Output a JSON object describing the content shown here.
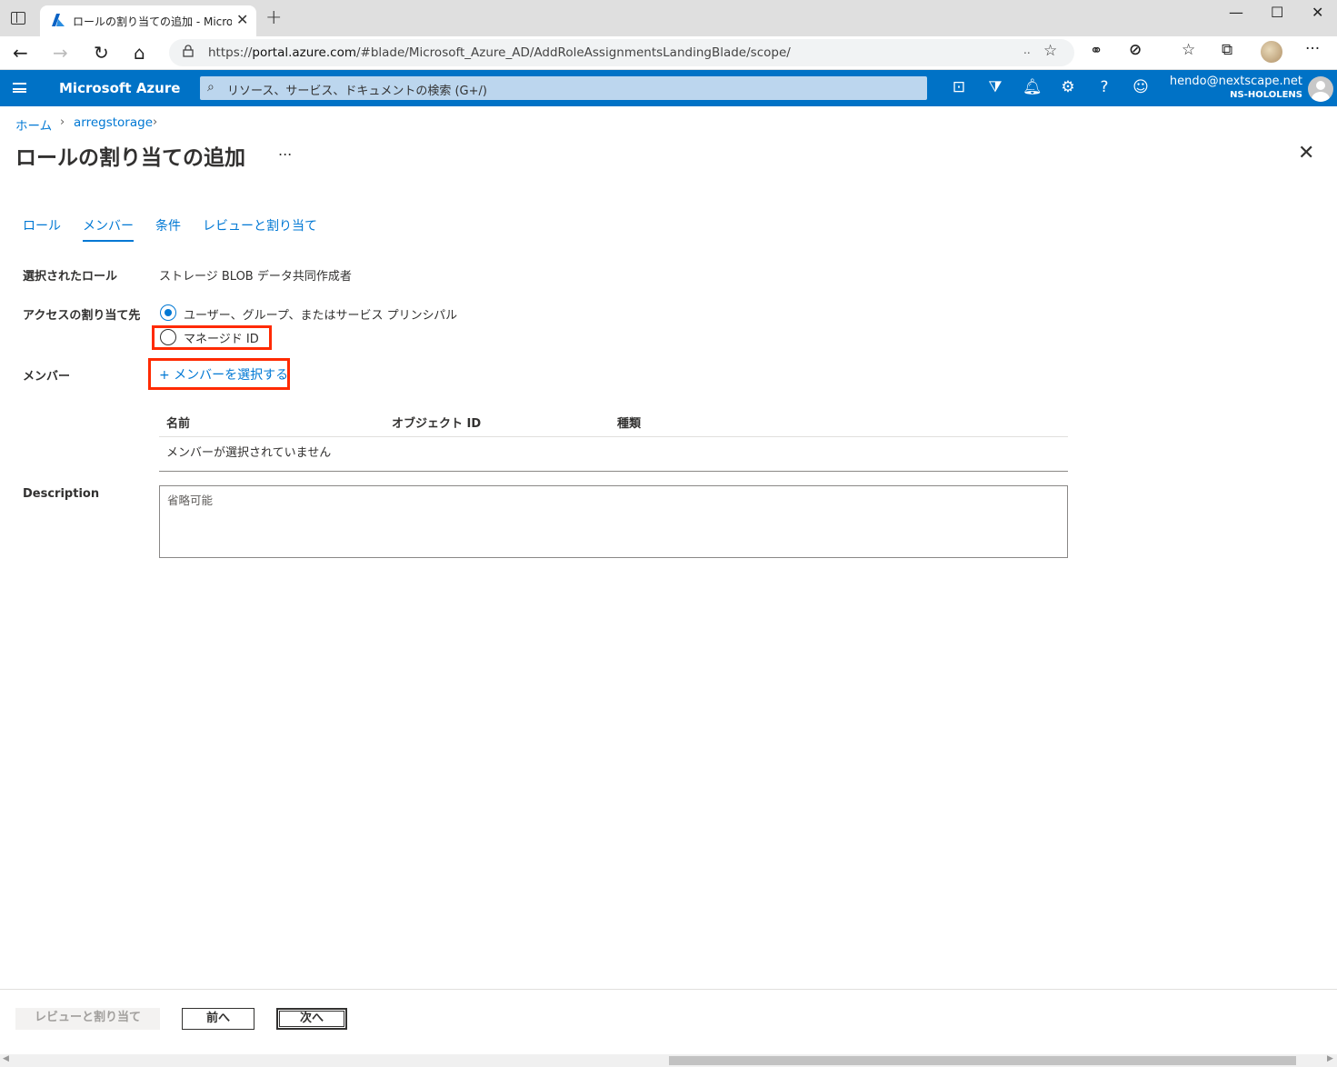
{
  "browser": {
    "tab_title": "ロールの割り当ての追加 - Microsoft",
    "url_prefix": "https://",
    "url_host": "portal.azure.com",
    "url_path": "/#blade/Microsoft_Azure_AD/AddRoleAssignmentsLandingBlade/scope/",
    "url_ellipsis": ".."
  },
  "azure": {
    "brand": "Microsoft Azure",
    "search_placeholder": "リソース、サービス、ドキュメントの検索 (G+/)",
    "user_email": "hendo@nextscape.net",
    "user_tenant": "NS-HOLOLENS"
  },
  "breadcrumb": {
    "home": "ホーム",
    "storage": "arregstorage"
  },
  "page": {
    "title": "ロールの割り当ての追加",
    "more": "..."
  },
  "tabs": [
    {
      "label": "ロール"
    },
    {
      "label": "メンバー"
    },
    {
      "label": "条件"
    },
    {
      "label": "レビューと割り当て"
    }
  ],
  "form": {
    "selected_role_label": "選択されたロール",
    "selected_role_value": "ストレージ BLOB データ共同作成者",
    "assign_to_label": "アクセスの割り当て先",
    "option_user": "ユーザー、グループ、またはサービス プリンシパル",
    "option_managed": "マネージド ID",
    "members_label": "メンバー",
    "select_members": "+ メンバーを選択する",
    "table_headers": [
      "名前",
      "オブジェクト ID",
      "種類"
    ],
    "table_empty": "メンバーが選択されていません",
    "description_label": "Description",
    "description_placeholder": "省略可能"
  },
  "footer": {
    "review_assign": "レビューと割り当て",
    "prev": "前へ",
    "next": "次へ"
  },
  "colors": {
    "accent": "#0078d4",
    "header": "#0072c6",
    "highlight": "#ff2a00"
  }
}
